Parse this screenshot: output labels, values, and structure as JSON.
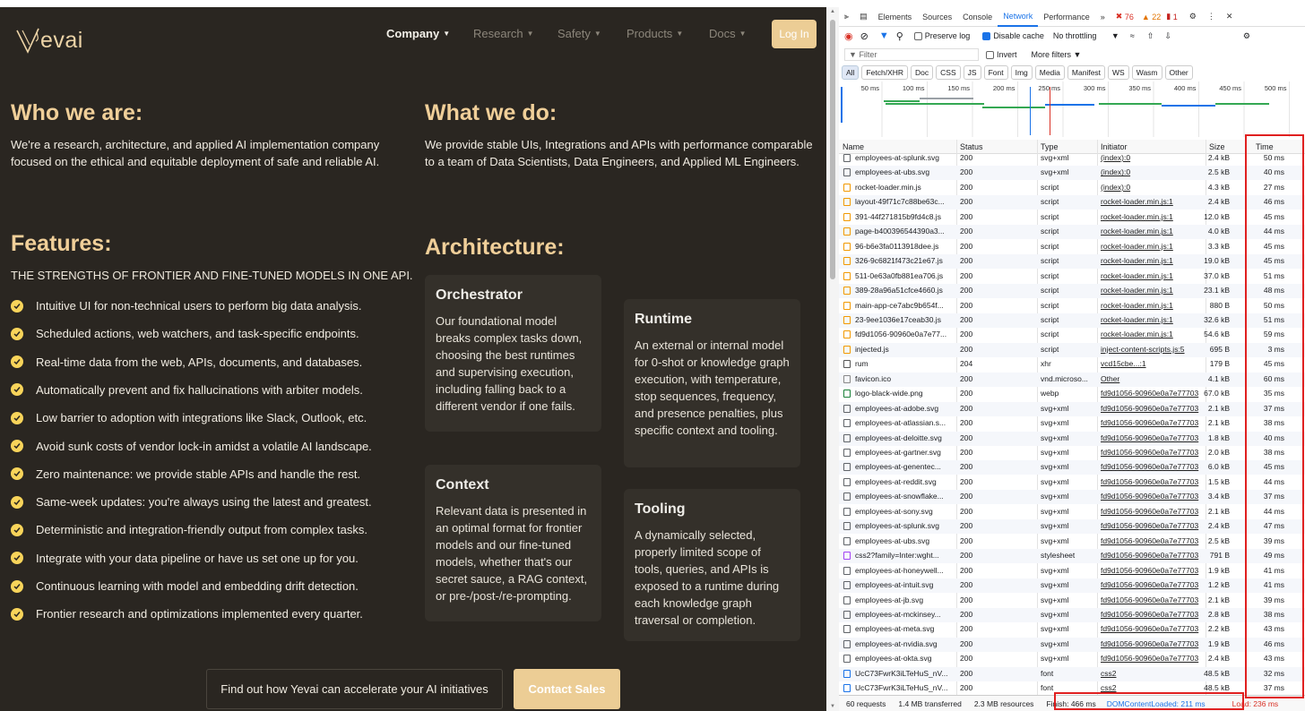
{
  "site": {
    "logo_text": "evai",
    "nav": [
      {
        "label": "Company",
        "active": true
      },
      {
        "label": "Research",
        "active": false
      },
      {
        "label": "Safety",
        "active": false
      },
      {
        "label": "Products",
        "active": false
      },
      {
        "label": "Docs",
        "active": false
      }
    ],
    "login_label": "Log In",
    "who_title": "Who we are:",
    "who_text": "We're a research, architecture, and applied AI implementation company focused on the ethical and equitable deployment of safe and reliable AI.",
    "what_title": "What we do:",
    "what_text": "We provide stable UIs, Integrations and APIs with performance comparable to a team of Data Scientists, Data Engineers, and Applied ML Engineers.",
    "features_title": "Features:",
    "features_subtitle": "THE STRENGTHS OF FRONTIER AND FINE-TUNED MODELS IN ONE API.",
    "features": [
      "Intuitive UI for non-technical users to perform big data analysis.",
      "Scheduled actions, web watchers, and task-specific endpoints.",
      "Real-time data from the web, APIs, documents, and databases.",
      "Automatically prevent and fix hallucinations with arbiter models.",
      "Low barrier to adoption with integrations like Slack, Outlook, etc.",
      "Avoid sunk costs of vendor lock-in amidst a volatile AI landscape.",
      "Zero maintenance: we provide stable APIs and handle the rest.",
      "Same-week updates: you're always using the latest and greatest.",
      "Deterministic and integration-friendly output from complex tasks.",
      "Integrate with your data pipeline or have us set one up for you.",
      "Continuous learning with model and embedding drift detection.",
      "Frontier research and optimizations implemented every quarter."
    ],
    "arch_title": "Architecture:",
    "cards": [
      {
        "title": "Orchestrator",
        "body": "Our foundational model breaks complex tasks down, choosing the best runtimes and supervising execution, including falling back to a different vendor if one fails."
      },
      {
        "title": "Runtime",
        "body": "An external or internal model for 0-shot or knowledge graph execution, with temperature, stop sequences, frequency, and presence penalties, plus specific context and tooling."
      },
      {
        "title": "Context",
        "body": "Relevant data is presented in an optimal format for frontier models and our fine-tuned models, whether that's our secret sauce, a RAG context, or pre-/post-/re-prompting."
      },
      {
        "title": "Tooling",
        "body": "A dynamically selected, properly limited scope of tools, queries, and APIs is exposed to a runtime during each knowledge graph traversal or completion."
      }
    ],
    "cta_text": "Find out how Yevai can accelerate your AI initiatives",
    "cta_button": "Contact Sales",
    "colors": {
      "bg": "#2a2621",
      "accent": "#eccd95",
      "heading": "#f0cf99",
      "check": "#f8d45a"
    }
  },
  "devtools": {
    "tabs": [
      "Elements",
      "Sources",
      "Console",
      "Network",
      "Performance"
    ],
    "active_tab": "Network",
    "more_tabs": "»",
    "errors": "76",
    "warnings": "22",
    "issues": "1",
    "preserve_log": "Preserve log",
    "disable_cache": "Disable cache",
    "throttle": "No throttling",
    "filter_placeholder": "Filter",
    "invert": "Invert",
    "more_filters": "More filters",
    "type_filters": [
      "All",
      "Fetch/XHR",
      "Doc",
      "CSS",
      "JS",
      "Font",
      "Img",
      "Media",
      "Manifest",
      "WS",
      "Wasm",
      "Other"
    ],
    "timeline_ticks": [
      "50 ms",
      "100 ms",
      "150 ms",
      "200 ms",
      "250 ms",
      "300 ms",
      "350 ms",
      "400 ms",
      "450 ms",
      "500 ms"
    ],
    "columns": [
      "Name",
      "Status",
      "Type",
      "Initiator",
      "Size",
      "Time"
    ],
    "rows": [
      [
        "employees-at-splunk.svg",
        "200",
        "svg+xml",
        "(index):0",
        "2.4 kB",
        "50 ms"
      ],
      [
        "employees-at-ubs.svg",
        "200",
        "svg+xml",
        "(index):0",
        "2.5 kB",
        "40 ms"
      ],
      [
        "rocket-loader.min.js",
        "200",
        "script",
        "(index):0",
        "4.3 kB",
        "27 ms"
      ],
      [
        "layout-49f71c7c88be63c...",
        "200",
        "script",
        "rocket-loader.min.js:1",
        "2.4 kB",
        "46 ms"
      ],
      [
        "391-44f271815b9fd4c8.js",
        "200",
        "script",
        "rocket-loader.min.js:1",
        "12.0 kB",
        "45 ms"
      ],
      [
        "page-b400396544390a3...",
        "200",
        "script",
        "rocket-loader.min.js:1",
        "4.0 kB",
        "44 ms"
      ],
      [
        "96-b6e3fa0113918dee.js",
        "200",
        "script",
        "rocket-loader.min.js:1",
        "3.3 kB",
        "45 ms"
      ],
      [
        "326-9c6821f473c21e67.js",
        "200",
        "script",
        "rocket-loader.min.js:1",
        "19.0 kB",
        "45 ms"
      ],
      [
        "511-0e63a0fb881ea706.js",
        "200",
        "script",
        "rocket-loader.min.js:1",
        "37.0 kB",
        "51 ms"
      ],
      [
        "389-28a96a51cfce4660.js",
        "200",
        "script",
        "rocket-loader.min.js:1",
        "23.1 kB",
        "48 ms"
      ],
      [
        "main-app-ce7abc9b654f...",
        "200",
        "script",
        "rocket-loader.min.js:1",
        "880 B",
        "50 ms"
      ],
      [
        "23-9ee1036e17ceab30.js",
        "200",
        "script",
        "rocket-loader.min.js:1",
        "32.6 kB",
        "51 ms"
      ],
      [
        "fd9d1056-90960e0a7e77...",
        "200",
        "script",
        "rocket-loader.min.js:1",
        "54.6 kB",
        "59 ms"
      ],
      [
        "injected.js",
        "200",
        "script",
        "inject-content-scripts.js:5",
        "695 B",
        "3 ms"
      ],
      [
        "rum",
        "204",
        "xhr",
        "vcd15cbe...:1",
        "179 B",
        "45 ms"
      ],
      [
        "favicon.ico",
        "200",
        "vnd.microso...",
        "Other",
        "4.1 kB",
        "60 ms"
      ],
      [
        "logo-black-wide.png",
        "200",
        "webp",
        "fd9d1056-90960e0a7e77703",
        "67.0 kB",
        "35 ms"
      ],
      [
        "employees-at-adobe.svg",
        "200",
        "svg+xml",
        "fd9d1056-90960e0a7e77703",
        "2.1 kB",
        "37 ms"
      ],
      [
        "employees-at-atlassian.s...",
        "200",
        "svg+xml",
        "fd9d1056-90960e0a7e77703",
        "2.1 kB",
        "38 ms"
      ],
      [
        "employees-at-deloitte.svg",
        "200",
        "svg+xml",
        "fd9d1056-90960e0a7e77703",
        "1.8 kB",
        "40 ms"
      ],
      [
        "employees-at-gartner.svg",
        "200",
        "svg+xml",
        "fd9d1056-90960e0a7e77703",
        "2.0 kB",
        "38 ms"
      ],
      [
        "employees-at-genentec...",
        "200",
        "svg+xml",
        "fd9d1056-90960e0a7e77703",
        "6.0 kB",
        "45 ms"
      ],
      [
        "employees-at-reddit.svg",
        "200",
        "svg+xml",
        "fd9d1056-90960e0a7e77703",
        "1.5 kB",
        "44 ms"
      ],
      [
        "employees-at-snowflake...",
        "200",
        "svg+xml",
        "fd9d1056-90960e0a7e77703",
        "3.4 kB",
        "37 ms"
      ],
      [
        "employees-at-sony.svg",
        "200",
        "svg+xml",
        "fd9d1056-90960e0a7e77703",
        "2.1 kB",
        "44 ms"
      ],
      [
        "employees-at-splunk.svg",
        "200",
        "svg+xml",
        "fd9d1056-90960e0a7e77703",
        "2.4 kB",
        "47 ms"
      ],
      [
        "employees-at-ubs.svg",
        "200",
        "svg+xml",
        "fd9d1056-90960e0a7e77703",
        "2.5 kB",
        "39 ms"
      ],
      [
        "css2?family=Inter:wght...",
        "200",
        "stylesheet",
        "fd9d1056-90960e0a7e77703",
        "791 B",
        "49 ms"
      ],
      [
        "employees-at-honeywell...",
        "200",
        "svg+xml",
        "fd9d1056-90960e0a7e77703",
        "1.9 kB",
        "41 ms"
      ],
      [
        "employees-at-intuit.svg",
        "200",
        "svg+xml",
        "fd9d1056-90960e0a7e77703",
        "1.2 kB",
        "41 ms"
      ],
      [
        "employees-at-jb.svg",
        "200",
        "svg+xml",
        "fd9d1056-90960e0a7e77703",
        "2.1 kB",
        "39 ms"
      ],
      [
        "employees-at-mckinsey...",
        "200",
        "svg+xml",
        "fd9d1056-90960e0a7e77703",
        "2.8 kB",
        "38 ms"
      ],
      [
        "employees-at-meta.svg",
        "200",
        "svg+xml",
        "fd9d1056-90960e0a7e77703",
        "2.2 kB",
        "43 ms"
      ],
      [
        "employees-at-nvidia.svg",
        "200",
        "svg+xml",
        "fd9d1056-90960e0a7e77703",
        "1.9 kB",
        "46 ms"
      ],
      [
        "employees-at-okta.svg",
        "200",
        "svg+xml",
        "fd9d1056-90960e0a7e77703",
        "2.4 kB",
        "43 ms"
      ],
      [
        "UcC73FwrK3iLTeHuS_nV...",
        "200",
        "font",
        "css2",
        "48.5 kB",
        "32 ms"
      ],
      [
        "UcC73FwrK3iLTeHuS_nV...",
        "200",
        "font",
        "css2",
        "48.5 kB",
        "37 ms"
      ]
    ],
    "status": {
      "requests": "60 requests",
      "transferred": "1.4 MB transferred",
      "resources": "2.3 MB resources",
      "finish": "Finish: 466 ms",
      "dcl": "DOMContentLoaded: 211 ms",
      "load": "Load: 236 ms"
    }
  }
}
